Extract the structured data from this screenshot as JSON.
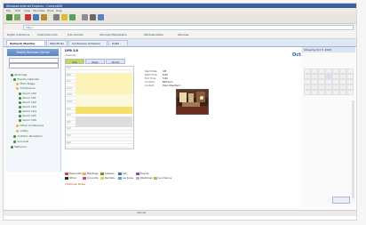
{
  "window": {
    "title": "Windows Internet Explorer - ContentDM"
  },
  "menubar": {
    "items": [
      "File",
      "Edit",
      "View",
      "Favorites",
      "Tools",
      "Help"
    ]
  },
  "address": {
    "url": "http://"
  },
  "links": [
    "Digital Collections",
    "Customize Links",
    "Free Hotmail",
    "Windows Marketplace",
    "Windows Media",
    "Windows"
  ],
  "tabs": [
    {
      "label": "Network Monitor"
    },
    {
      "label": "Web Photo"
    },
    {
      "label": "Conference Schedule"
    },
    {
      "label": "DLBA"
    }
  ],
  "sidebar": {
    "title": "Shelby Ballroom Rental",
    "tree": [
      "Bookings",
      "Events Calendar",
      "Main Stage",
      "Conference",
      "Room 100",
      "Room 101",
      "Room 102",
      "Room 103",
      "Room 104",
      "Room 105",
      "Room 106",
      "Other Conference",
      "Lobby",
      "Outdoor Reception",
      "Grounds",
      "Ballroom"
    ]
  },
  "main": {
    "breadcrumb": "DPB 3/8",
    "subtitle": "Calendar",
    "tabs": [
      "Day",
      "Week",
      "Month"
    ],
    "times": [
      "7am",
      "",
      "8am",
      "",
      "9am",
      "",
      "10am",
      "",
      "11am",
      "",
      "12pm",
      "",
      "1pm",
      "",
      "2pm",
      "",
      "3pm",
      "",
      "4pm",
      "",
      "5pm",
      "",
      "6pm",
      "",
      "7pm"
    ],
    "details": [
      {
        "label": "Start Date:",
        "value": "3/8"
      },
      {
        "label": "Start Time:",
        "value": "8:00"
      },
      {
        "label": "End Time:",
        "value": "5:00"
      },
      {
        "label": "Location:",
        "value": "Ballroom"
      },
      {
        "label": "Contact:",
        "value": "Hans Shepherd"
      }
    ],
    "legend": [
      {
        "label": "Reservations",
        "color": "#d94a3a"
      },
      {
        "label": "Meetings",
        "color": "#f0b43c"
      },
      {
        "label": "Classes",
        "color": "#6b9a3b"
      },
      {
        "label": "Lab",
        "color": "#3b6fb6"
      },
      {
        "label": "Events",
        "color": "#8a4fb0"
      },
      {
        "label": "Other",
        "color": "#2a2a2a"
      },
      {
        "label": "Concerts",
        "color": "#c2478e"
      },
      {
        "label": "Recitals",
        "color": "#e0d04c"
      },
      {
        "label": "Lectures",
        "color": "#5aa6c8"
      },
      {
        "label": "Weddings",
        "color": "#b5b5b5"
      },
      {
        "label": "Luncheons",
        "color": "#9ac34f"
      }
    ],
    "note": "Additional Notes"
  },
  "right_panel": {
    "header": "Showing Oct 3, 2005",
    "date_big": "Oct 2005"
  },
  "status": {
    "text": "Internet"
  }
}
